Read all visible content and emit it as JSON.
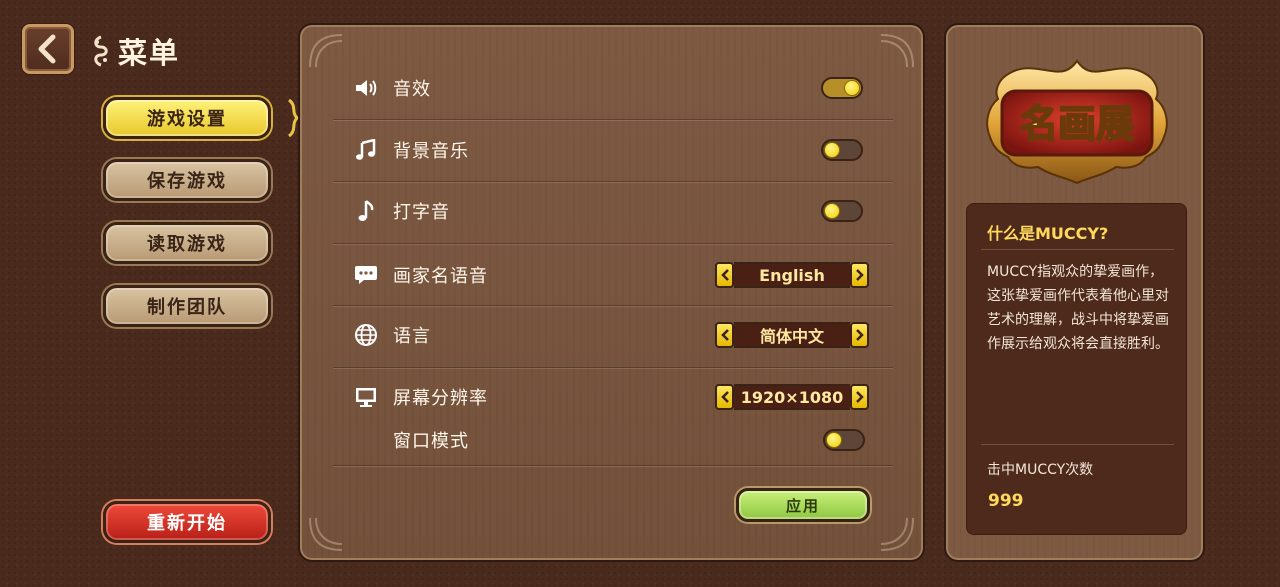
{
  "header": {
    "back_icon": "chevron-left-icon",
    "title": "菜单",
    "title_icon": "scroll-ornament-icon"
  },
  "nav": {
    "items": [
      {
        "label": "游戏设置",
        "active": true
      },
      {
        "label": "保存游戏",
        "active": false
      },
      {
        "label": "读取游戏",
        "active": false
      },
      {
        "label": "制作团队",
        "active": false
      }
    ],
    "restart_label": "重新开始"
  },
  "settings": {
    "sound_effects": {
      "label": "音效",
      "icon": "speaker-icon",
      "on": true
    },
    "bgm": {
      "label": "背景音乐",
      "icon": "music-notes-icon",
      "on": true
    },
    "typing_sound": {
      "label": "打字音",
      "icon": "music-note-icon",
      "on": true
    },
    "painter_voice": {
      "label": "画家名语音",
      "icon": "speech-bubble-icon",
      "value": "English"
    },
    "language": {
      "label": "语言",
      "icon": "globe-icon",
      "value": "简体中文"
    },
    "resolution": {
      "label": "屏幕分辨率",
      "icon": "monitor-icon",
      "value": "1920×1080"
    },
    "window_mode": {
      "label": "窗口模式",
      "on": true
    },
    "apply_label": "应用"
  },
  "side": {
    "logo_text": "名画展",
    "info_title": "什么是MUCCY?",
    "info_text": "MUCCY指观众的挚爱画作，这张挚爱画作代表着他心里对艺术的理解，战斗中将挚爱画作展示给观众将会直接胜利。",
    "hits_label": "击中MUCCY次数",
    "hits_value": "999"
  },
  "colors": {
    "background": "#4a2a1d",
    "panel": "#7e5a43",
    "accent_yellow": "#ffd95c",
    "active_tab": "#f5de4a",
    "restart_red": "#d6342a",
    "apply_green": "#a8dc58"
  }
}
